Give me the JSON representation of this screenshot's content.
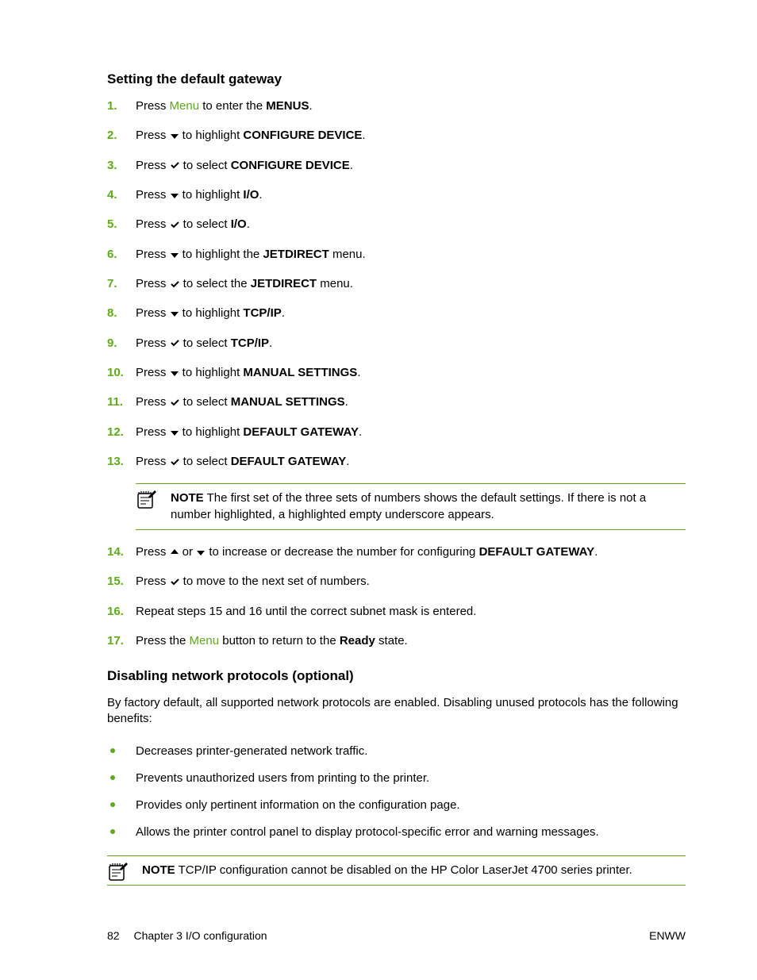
{
  "section1": {
    "heading": "Setting the default gateway",
    "steps": [
      {
        "n": "1.",
        "pre": "Press ",
        "link": "Menu",
        "post": " to enter the ",
        "bold": "MENUS",
        "tail": "."
      },
      {
        "n": "2.",
        "pre": "Press ",
        "icon": "down",
        "mid": " to highlight ",
        "bold": "CONFIGURE DEVICE",
        "tail": "."
      },
      {
        "n": "3.",
        "pre": "Press ",
        "icon": "check",
        "mid": " to select ",
        "bold": "CONFIGURE DEVICE",
        "tail": "."
      },
      {
        "n": "4.",
        "pre": "Press ",
        "icon": "down",
        "mid": " to highlight ",
        "bold": "I/O",
        "tail": "."
      },
      {
        "n": "5.",
        "pre": "Press ",
        "icon": "check",
        "mid": " to select ",
        "bold": "I/O",
        "tail": "."
      },
      {
        "n": "6.",
        "pre": "Press ",
        "icon": "down",
        "mid": " to highlight the ",
        "bold": "JETDIRECT",
        "tail": " menu."
      },
      {
        "n": "7.",
        "pre": "Press ",
        "icon": "check",
        "mid": " to select the ",
        "bold": "JETDIRECT",
        "tail": " menu."
      },
      {
        "n": "8.",
        "pre": "Press ",
        "icon": "down",
        "mid": " to highlight ",
        "bold": "TCP/IP",
        "tail": "."
      },
      {
        "n": "9.",
        "pre": "Press ",
        "icon": "check",
        "mid": " to select ",
        "bold": "TCP/IP",
        "tail": "."
      },
      {
        "n": "10.",
        "pre": "Press ",
        "icon": "down",
        "mid": " to highlight ",
        "bold": "MANUAL SETTINGS",
        "tail": "."
      },
      {
        "n": "11.",
        "pre": "Press ",
        "icon": "check",
        "mid": " to select ",
        "bold": "MANUAL SETTINGS",
        "tail": "."
      },
      {
        "n": "12.",
        "pre": "Press ",
        "icon": "down",
        "mid": " to highlight ",
        "bold": "DEFAULT GATEWAY",
        "tail": "."
      },
      {
        "n": "13.",
        "pre": "Press ",
        "icon": "check",
        "mid": " to select ",
        "bold": "DEFAULT GATEWAY",
        "tail": "."
      }
    ],
    "note1": {
      "label": "NOTE",
      "text": "   The first set of the three sets of numbers shows the default settings. If there is not a number highlighted, a highlighted empty underscore appears."
    },
    "steps2": [
      {
        "n": "14.",
        "pre": "Press ",
        "icon": "up",
        "mid1": " or ",
        "icon2": "down",
        "mid2": " to increase or decrease the number for configuring ",
        "bold": "DEFAULT GATEWAY",
        "tail": "."
      },
      {
        "n": "15.",
        "pre": "Press ",
        "icon": "check",
        "mid": " to move to the next set of numbers.",
        "bold": "",
        "tail": ""
      },
      {
        "n": "16.",
        "plain": "Repeat steps 15 and 16 until the correct subnet mask is entered."
      },
      {
        "n": "17.",
        "pre": "Press the ",
        "link": "Menu",
        "mid": " button to return to the ",
        "bold": "Ready",
        "tail": " state."
      }
    ]
  },
  "section2": {
    "heading": "Disabling network protocols (optional)",
    "intro": "By factory default, all supported network protocols are enabled. Disabling unused protocols has the following benefits:",
    "bullets": [
      "Decreases printer-generated network traffic.",
      "Prevents unauthorized users from printing to the printer.",
      "Provides only pertinent information on the configuration page.",
      "Allows the printer control panel to display protocol-specific error and warning messages."
    ],
    "note2": {
      "label": "NOTE",
      "text": "   TCP/IP configuration cannot be disabled on the HP Color LaserJet 4700 series printer."
    }
  },
  "footer": {
    "page": "82",
    "chapter": "Chapter 3    I/O configuration",
    "right": "ENWW"
  }
}
